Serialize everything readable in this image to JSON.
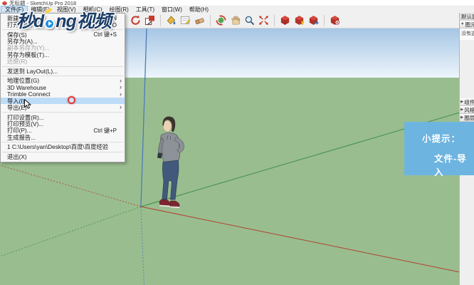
{
  "window": {
    "title": "无标题 - SketchUp Pro 2018"
  },
  "menu_bar": {
    "items": [
      {
        "label": "文件(F)",
        "name": "menubar-file",
        "active": true
      },
      {
        "label": "编辑(E)",
        "name": "menubar-edit"
      },
      {
        "label": "视图(V)",
        "name": "menubar-view"
      },
      {
        "label": "相机(C)",
        "name": "menubar-camera"
      },
      {
        "label": "绘图(R)",
        "name": "menubar-draw"
      },
      {
        "label": "工具(T)",
        "name": "menubar-tools"
      },
      {
        "label": "窗口(W)",
        "name": "menubar-window"
      },
      {
        "label": "帮助(H)",
        "name": "menubar-help"
      }
    ]
  },
  "toolbar": {
    "items": [
      {
        "icon": "redo-icon",
        "name": "redo-button"
      },
      {
        "icon": "make-component-icon",
        "name": "make-component-button"
      },
      {
        "sep": true
      },
      {
        "icon": "paint-bucket-icon",
        "name": "paint-bucket-button"
      },
      {
        "icon": "text-label-icon",
        "name": "text-label-button"
      },
      {
        "icon": "eraser-icon",
        "name": "eraser-button"
      },
      {
        "sep": true
      },
      {
        "icon": "orbit-icon",
        "name": "orbit-button"
      },
      {
        "icon": "pan-icon",
        "name": "pan-button"
      },
      {
        "icon": "zoom-icon",
        "name": "zoom-button"
      },
      {
        "icon": "zoom-extents-icon",
        "name": "zoom-extents-button"
      },
      {
        "sep": true
      },
      {
        "icon": "get-models-icon",
        "name": "get-models-button"
      },
      {
        "icon": "share-model-icon",
        "name": "share-model-button"
      },
      {
        "icon": "share-component-icon",
        "name": "share-component-button"
      },
      {
        "sep": true
      },
      {
        "icon": "extension-warehouse-icon",
        "name": "extension-warehouse-button"
      }
    ]
  },
  "file_menu": {
    "items": [
      {
        "label": "新建(N)",
        "shortcut": "Ctrl 键+N",
        "name": "file-menu-item-new"
      },
      {
        "label": "打开(O)...",
        "shortcut": "Ctrl 键+O",
        "name": "file-menu-item-open"
      },
      {
        "sep": true
      },
      {
        "label": "保存(S)",
        "shortcut": "Ctrl 键+S",
        "name": "file-menu-item-save"
      },
      {
        "label": "另存为(A)...",
        "name": "file-menu-item-save-as"
      },
      {
        "label": "副本另存为(Y)...",
        "disabled": true,
        "name": "file-menu-item-save-copy-as"
      },
      {
        "label": "另存为模板(T)...",
        "name": "file-menu-item-save-as-template"
      },
      {
        "label": "还原(R)",
        "disabled": true,
        "name": "file-menu-item-revert"
      },
      {
        "sep": true
      },
      {
        "label": "发送到 LayOut(L)...",
        "name": "file-menu-item-send-to-layout"
      },
      {
        "sep": true
      },
      {
        "label": "地理位置(G)",
        "arrow": "›",
        "name": "file-menu-item-geo-location"
      },
      {
        "label": "3D Warehouse",
        "arrow": "›",
        "name": "file-menu-item-3d-warehouse"
      },
      {
        "label": "Trimble Connect",
        "arrow": "›",
        "name": "file-menu-item-trimble-connect"
      },
      {
        "label": "导入(I)...",
        "highlighted": true,
        "name": "file-menu-item-import"
      },
      {
        "label": "导出(E)",
        "arrow": "›",
        "name": "file-menu-item-export"
      },
      {
        "sep": true
      },
      {
        "label": "打印设置(R)...",
        "name": "file-menu-item-print-setup"
      },
      {
        "label": "打印预览(V)...",
        "name": "file-menu-item-print-preview"
      },
      {
        "label": "打印(P)...",
        "shortcut": "Ctrl 键+P",
        "name": "file-menu-item-print"
      },
      {
        "label": "生成报告...",
        "name": "file-menu-item-generate-report"
      },
      {
        "sep": true
      },
      {
        "label": "1 C:\\Users\\yan\\Desktop\\百度\\百度经验",
        "name": "file-menu-item-recent-file-1"
      },
      {
        "sep": true
      },
      {
        "label": "退出(X)",
        "name": "file-menu-item-exit"
      }
    ]
  },
  "right_panel": {
    "title": "默认面板",
    "sections": [
      {
        "label": "图元信息",
        "arrow": "▼",
        "body": "没有选择任何内容",
        "name": "panel-entity-info"
      },
      {
        "label": "组件",
        "arrow": "▶",
        "gap_before": true,
        "name": "panel-components"
      },
      {
        "label": "风格",
        "arrow": "▶",
        "name": "panel-styles"
      },
      {
        "label": "图层",
        "arrow": "▶",
        "name": "panel-layers"
      }
    ]
  },
  "tip_box": {
    "title": "小提示：",
    "text": "文件-导入",
    "bg": "#6db4e0"
  },
  "watermark": {
    "part1": "秒d",
    "part2": "ng",
    "part3": "视频"
  },
  "viewport": {
    "colors": {
      "sky_top": "#a6c6e4",
      "sky_horizon": "#edf5fb",
      "ground": "#99bd8f",
      "axis_red": "#b2402e",
      "axis_green": "#3f8f49",
      "axis_blue": "#4a7cba"
    }
  }
}
